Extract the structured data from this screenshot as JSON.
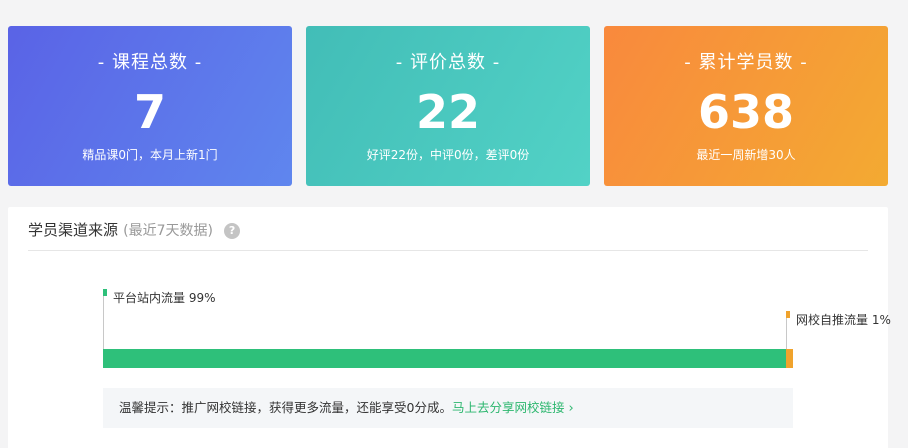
{
  "cards": [
    {
      "title": "- 课程总数 -",
      "value": "7",
      "sub": "精品课0门，本月上新1门"
    },
    {
      "title": "- 评价总数 -",
      "value": "22",
      "sub": "好评22份，中评0份，差评0份"
    },
    {
      "title": "- 累计学员数 -",
      "value": "638",
      "sub": "最近一周新增30人"
    }
  ],
  "channel": {
    "title": "学员渠道来源",
    "hint": "(最近7天数据)",
    "help_icon": "question-circle-icon",
    "segments": [
      {
        "label": "平台站内流量 99%",
        "percent": 99,
        "color": "#2ec07a",
        "cap_color": "#2ec07a"
      },
      {
        "label": "网校自推流量 1%",
        "percent": 1,
        "color": "#f0a32c",
        "cap_color": "#f0a32c"
      }
    ]
  },
  "tip": {
    "text": "温馨提示：推广网校链接，获得更多流量，还能享受0分成。",
    "link": "马上去分享网校链接",
    "link_icon": "chevron-right-icon"
  }
}
